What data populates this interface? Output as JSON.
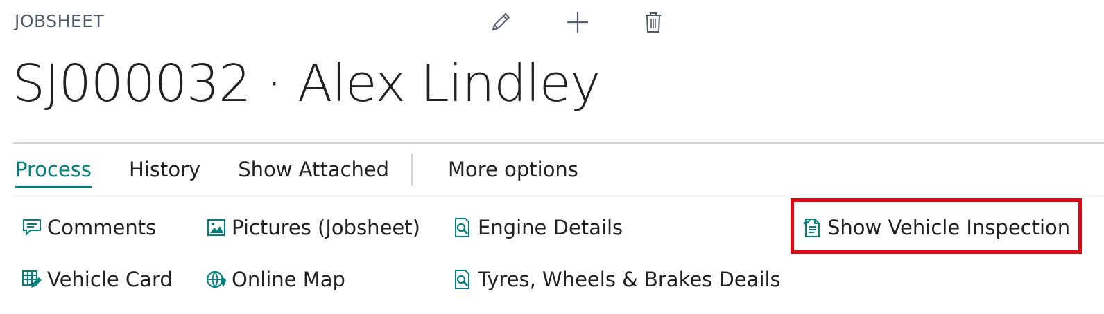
{
  "header": {
    "caption": "JOBSHEET",
    "title": "SJ000032 · Alex Lindley",
    "actions": [
      {
        "name": "edit",
        "icon": "pencil-icon"
      },
      {
        "name": "new",
        "icon": "plus-icon"
      },
      {
        "name": "delete",
        "icon": "trash-icon"
      }
    ]
  },
  "tabs": {
    "items": [
      {
        "label": "Process",
        "active": true
      },
      {
        "label": "History",
        "active": false
      },
      {
        "label": "Show Attached",
        "active": false
      }
    ],
    "more_label": "More options"
  },
  "actions": {
    "comments": "Comments",
    "pictures": "Pictures (Jobsheet)",
    "engine_details": "Engine Details",
    "show_vehicle_inspection": "Show Vehicle Inspection",
    "vehicle_card": "Vehicle Card",
    "online_map": "Online Map",
    "tyres_wheels_brakes": "Tyres, Wheels & Brakes Deails"
  },
  "colors": {
    "accent": "#00817c",
    "highlight": "#e30613",
    "caption": "#505c6d"
  }
}
